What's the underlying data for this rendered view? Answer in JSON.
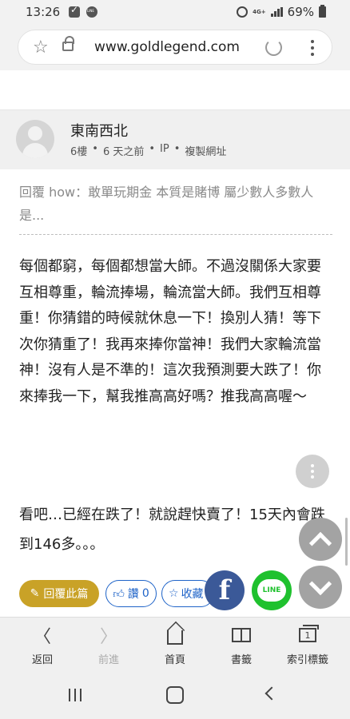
{
  "status_bar": {
    "time": "13:26",
    "network": "4G+",
    "battery": "69%",
    "icons": [
      "check-app-icon",
      "line-app-icon",
      "alarm-icon",
      "signal-icon",
      "battery-icon"
    ]
  },
  "browser": {
    "url": "www.goldlegend.com",
    "icons": [
      "star-icon",
      "lock-icon",
      "reload-icon",
      "more-vert-icon"
    ]
  },
  "post": {
    "author": "東南西北",
    "floor": "6樓",
    "time_ago": "6 天之前",
    "ip": "IP",
    "copy_link": "複製網址",
    "reply_quote": "回覆 how：敢單玩期金 本質是賭博 屬少數人多數人是...",
    "content_p1": "每個都窮，每個都想當大師。不過沒關係大家要互相尊重，輪流捧場，輪流當大師。我們互相尊重！你猜錯的時候就休息一下！換別人猜！等下次你猜重了！我再來捧你當神！我們大家輪流當神！沒有人是不準的！這次我預測要大跌了！你來捧我一下，幫我推高高好嗎？推我高高喔～",
    "content_p2": "看吧…已經在跌了！就說趕快賣了！15天內會跌到146多。。。"
  },
  "actions": {
    "reply_label": "回覆此篇",
    "like_label": "讚",
    "like_count": "0",
    "fav_label": "收藏",
    "reply_color": "#c9a227",
    "accent_color": "#1e63c8"
  },
  "share": {
    "facebook_glyph": "f",
    "line_label": "LINE",
    "facebook_color": "#3b5998",
    "line_color": "#1fc12e"
  },
  "bottom_nav": {
    "back": "返回",
    "forward": "前進",
    "home": "首頁",
    "bookmarks": "書籤",
    "index_tabs": "索引標籤",
    "tab_count": "1"
  }
}
